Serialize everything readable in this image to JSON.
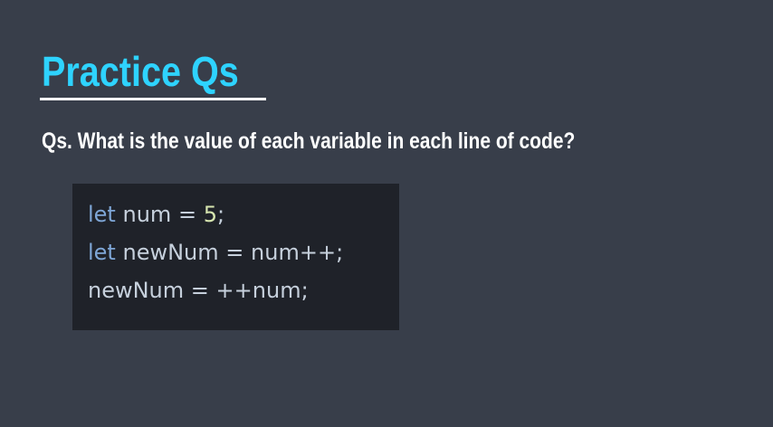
{
  "slide": {
    "title": "Practice Qs",
    "question": "Qs. What is the value of each variable in each line of code?"
  },
  "code": {
    "line1": {
      "kw": "let",
      "name": "num",
      "op": "=",
      "value": "5",
      "end": ";"
    },
    "line2": {
      "kw": "let",
      "name": "newNum",
      "op": "=",
      "expr": "num++",
      "end": ";"
    },
    "line3": {
      "name": "newNum",
      "op": "=",
      "expr": "++num",
      "end": ";"
    }
  },
  "colors": {
    "background": "#383e4a",
    "title": "#2ed3ff",
    "code_background": "#1f2229",
    "keyword": "#7ea6d6",
    "number": "#d7e6b0"
  }
}
